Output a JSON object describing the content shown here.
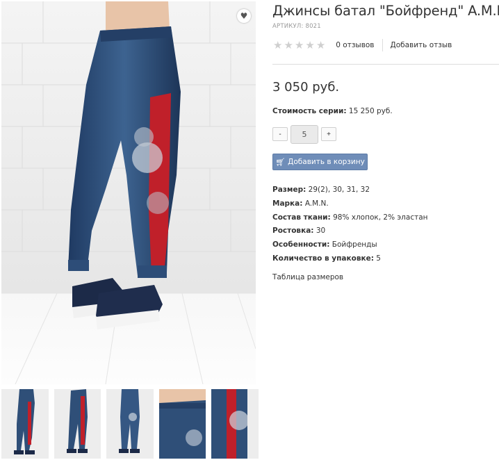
{
  "product": {
    "title": "Джинсы батал \"Бойфренд\" A.M.N.",
    "sku_label": "АРТИКУЛ:",
    "sku_value": "8021",
    "reviews_text": "0 отзывов",
    "add_review_label": "Добавить отзыв",
    "rating": 0,
    "rating_max": 5,
    "price": "3 050 руб.",
    "series_label": "Стоимость серии:",
    "series_value": "15 250 руб.",
    "quantity": "5",
    "minus_label": "-",
    "plus_label": "+",
    "add_to_cart_label": "Добавить в корзину",
    "size_table_link": "Таблица размеров"
  },
  "properties": [
    {
      "label": "Размер:",
      "value": "29(2), 30, 31, 32"
    },
    {
      "label": "Марка:",
      "value": "A.M.N."
    },
    {
      "label": "Состав ткани:",
      "value": "98% хлопок, 2% эластан"
    },
    {
      "label": "Ростовка:",
      "value": "30"
    },
    {
      "label": "Особенности:",
      "value": "Бойфренды"
    },
    {
      "label": "Количество в упаковке:",
      "value": "5"
    }
  ],
  "icons": {
    "favorite": "heart-icon",
    "star": "star-icon",
    "cart": "cart-icon"
  },
  "colors": {
    "accent_button": "#6f8db8",
    "star_inactive": "#cfcfcf",
    "denim": "#2f4f78",
    "stripe_red": "#c0202a"
  },
  "thumbnails": [
    {
      "name": "full-length-front"
    },
    {
      "name": "full-length-side"
    },
    {
      "name": "full-length-back"
    },
    {
      "name": "detail-waist"
    },
    {
      "name": "detail-stripe"
    }
  ]
}
